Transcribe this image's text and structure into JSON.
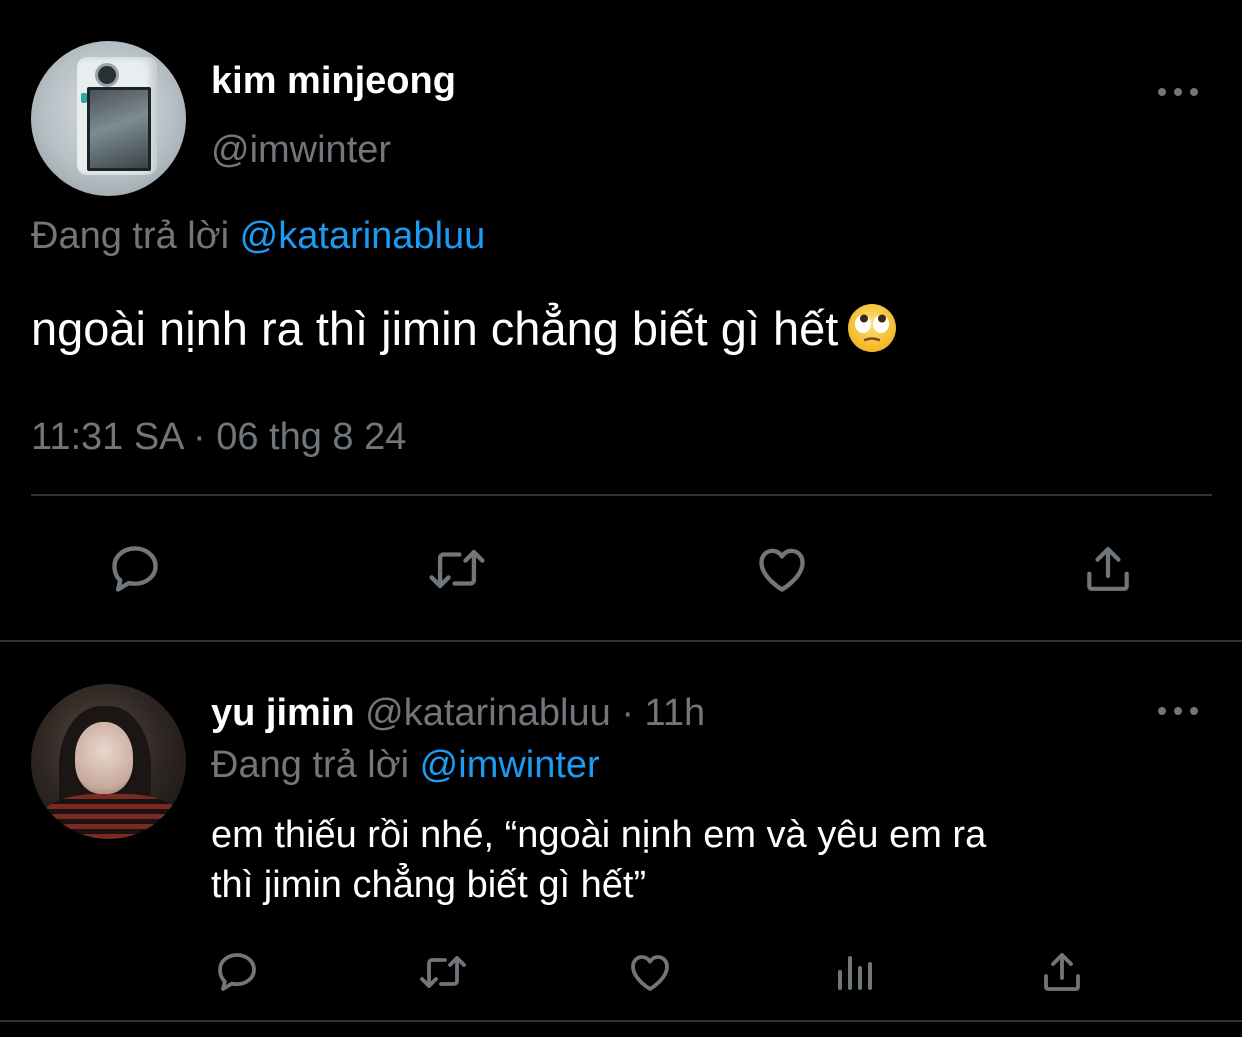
{
  "colors": {
    "background": "#000000",
    "text_primary": "#ffffff",
    "text_secondary": "#71767b",
    "link": "#1d9bf0",
    "divider": "#2f3336"
  },
  "main_tweet": {
    "author_name": "kim minjeong",
    "author_handle": "@imwinter",
    "reply_prefix": "Đang trả lời",
    "reply_target": "@katarinabluu",
    "text": "ngoài nịnh ra thì jimin chẳng biết gì hết",
    "emoji": "face-with-rolling-eyes",
    "timestamp": "11:31 SA · 06 thg 8 24",
    "actions": [
      "reply-icon",
      "retweet-icon",
      "like-icon",
      "share-icon"
    ]
  },
  "reply_tweet": {
    "author_name": "yu jimin",
    "author_handle": "@katarinabluu",
    "separator": "·",
    "age": "11h",
    "reply_prefix": "Đang trả lời",
    "reply_target": "@imwinter",
    "text_line_1": "em thiếu rồi nhé, “ngoài nịnh em và yêu em ra",
    "text_line_2": "thì jimin chẳng biết gì hết”",
    "actions": [
      "reply-icon",
      "retweet-icon",
      "like-icon",
      "views-icon",
      "share-icon"
    ]
  }
}
